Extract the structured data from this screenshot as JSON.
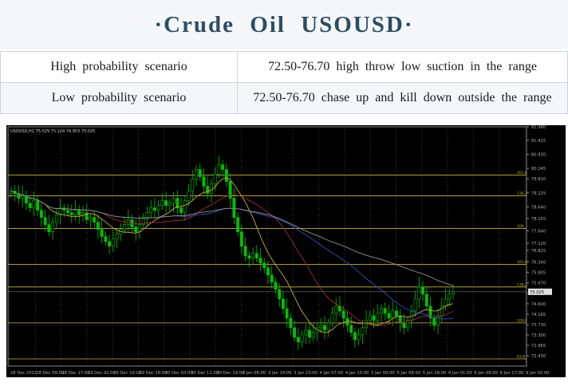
{
  "title": "·Crude  Oil  USOUSD·",
  "scenarios": [
    {
      "label": "High probability scenario",
      "text": "72.50-76.70 high throw low suction in the range"
    },
    {
      "label": "Low probability  scenario",
      "text": "72.50-76.70 chase up and kill down outside the range"
    }
  ],
  "chart_data": {
    "type": "candlestick",
    "symbol_header": "USOUSD,H1  75.029 75.124 74.953 75.025",
    "current_price_label": "75.025",
    "ylim": [
      72.0,
      81.98
    ],
    "y_ticks": [
      81.98,
      81.415,
      80.83,
      80.245,
      79.81,
      79.225,
      78.64,
      78.155,
      77.64,
      77.12,
      76.825,
      76.34,
      75.905,
      75.47,
      75.025,
      74.6,
      74.165,
      73.73,
      73.3,
      72.865,
      72.43
    ],
    "fib_levels": [
      {
        "label": "261.8",
        "value": 79.97
      },
      {
        "label": "138.2",
        "value": 79.1
      },
      {
        "label": "100",
        "value": 77.74
      },
      {
        "label": "161.8",
        "value": 76.24
      },
      {
        "label": "138.2",
        "value": 75.3
      },
      {
        "label": "100.0",
        "value": 73.8
      },
      {
        "label": "61.8",
        "value": 72.3
      }
    ],
    "x_labels": [
      "28 Dec 2022",
      "28 Dec 09:00",
      "28 Dec 17:00",
      "29 Dec 02:00",
      "29 Dec 10:00",
      "29 Dec 18:00",
      "30 Dec 03:00",
      "30 Dec 11:00",
      "30 Dec 19:00",
      "3 Jan 06:00",
      "3 Jan 14:00",
      "3 Jan 23:00",
      "4 Jan 07:00",
      "4 Jan 15:00",
      "5 Jan 00:00",
      "5 Jan 08:00",
      "5 Jan 16:00",
      "6 Jan 01:00",
      "6 Jan 09:00",
      "6 Jan 17:00",
      "9 Jan 02:00"
    ],
    "close": [
      79.3,
      79.2,
      79.0,
      79.1,
      78.8,
      78.6,
      78.9,
      78.5,
      78.2,
      77.9,
      77.6,
      78.0,
      78.3,
      78.6,
      78.5,
      78.4,
      78.3,
      78.5,
      78.3,
      78.4,
      78.1,
      78.2,
      78.0,
      77.7,
      77.4,
      77.2,
      77.0,
      77.3,
      77.5,
      77.7,
      77.9,
      78.1,
      77.8,
      77.6,
      77.9,
      78.2,
      78.4,
      78.6,
      78.5,
      78.7,
      78.9,
      78.7,
      78.8,
      79.0,
      78.6,
      78.4,
      78.9,
      79.3,
      79.8,
      80.2,
      79.9,
      79.5,
      79.2,
      79.6,
      80.0,
      80.4,
      80.2,
      79.7,
      79.0,
      78.2,
      77.6,
      77.0,
      76.6,
      76.5,
      76.7,
      76.5,
      76.3,
      76.1,
      75.8,
      75.5,
      75.2,
      74.8,
      74.4,
      74.0,
      73.6,
      73.2,
      73.0,
      73.3,
      73.5,
      73.2,
      73.4,
      73.6,
      73.7,
      73.5,
      73.8,
      74.2,
      74.5,
      74.3,
      74.0,
      73.7,
      73.4,
      73.1,
      73.3,
      73.6,
      73.9,
      74.1,
      73.9,
      74.2,
      74.4,
      74.2,
      74.0,
      74.3,
      74.1,
      73.8,
      73.6,
      73.9,
      74.3,
      74.8,
      75.3,
      75.0,
      74.5,
      74.0,
      73.7,
      74.1,
      74.5,
      74.8,
      75.0,
      75.1
    ]
  }
}
